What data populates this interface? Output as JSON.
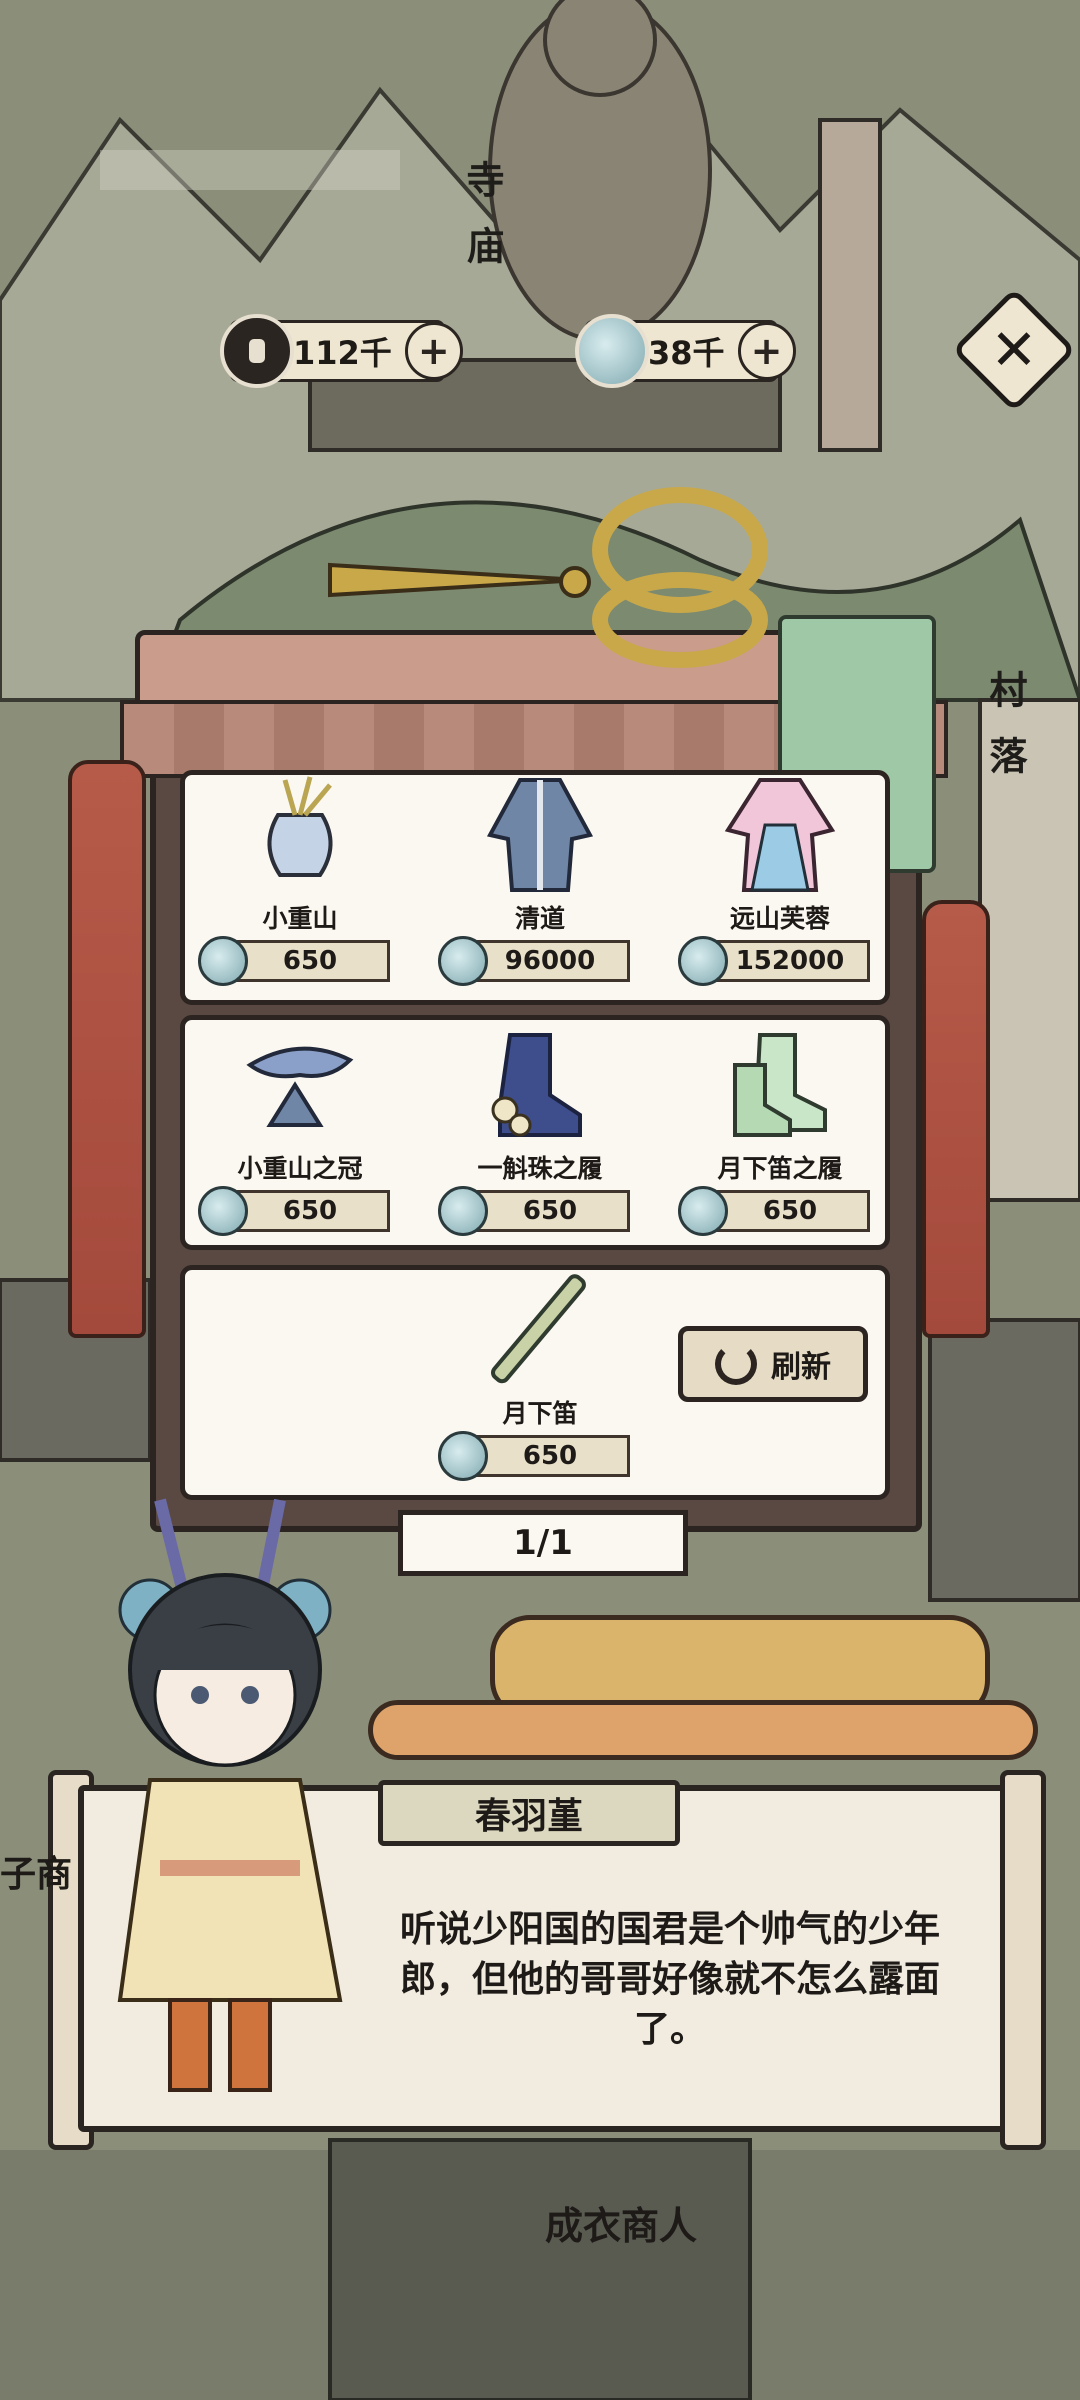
{
  "map_labels": {
    "temple": "寺庙",
    "village": "村落",
    "merchant": "成衣商人",
    "side_fragment": "子商"
  },
  "currency": {
    "coins": "112千",
    "jade": "38千",
    "plus_glyph": "+"
  },
  "close": {
    "glyph": "✕"
  },
  "shop": {
    "items": [
      {
        "name": "小重山",
        "price": "650",
        "icon": "vase-icon"
      },
      {
        "name": "清道",
        "price": "96000",
        "icon": "robe-icon"
      },
      {
        "name": "远山芙蓉",
        "price": "152000",
        "icon": "dress-icon"
      },
      {
        "name": "小重山之冠",
        "price": "650",
        "icon": "crown-icon"
      },
      {
        "name": "一斛珠之履",
        "price": "650",
        "icon": "boots-icon"
      },
      {
        "name": "月下笛之履",
        "price": "650",
        "icon": "shoes-icon"
      },
      {
        "name": "月下笛",
        "price": "650",
        "icon": "flute-icon"
      }
    ],
    "refresh_label": "刷新",
    "page_indicator": "1/1"
  },
  "dialog": {
    "speaker": "春羽堇",
    "text": "听说少阳国的国君是个帅气的少年郎，但他的哥哥好像就不怎么露面了。"
  }
}
